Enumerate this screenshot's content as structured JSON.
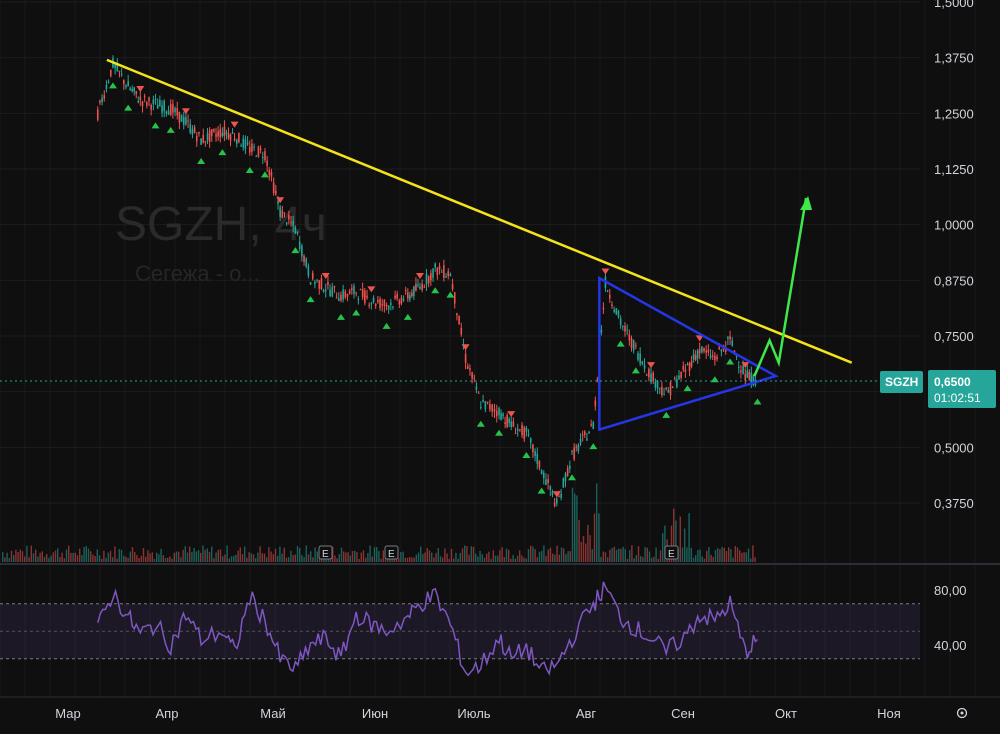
{
  "ticker": "SGZH",
  "watermark": {
    "symbol": "SGZH, 4ч",
    "name": "Сегежа - о..."
  },
  "price_badge": {
    "label": "SGZH",
    "price": "0,6500",
    "countdown": "01:02:51",
    "color": "#26a69a"
  },
  "colors": {
    "up": "#26a69a",
    "down": "#ef5350",
    "trendline": "#f5e31a",
    "triangle": "#2536e6",
    "projection": "#3ee84a",
    "rsi": "#7e57c2"
  },
  "event_marker_label": "E",
  "settings_icon": "gear-icon",
  "chart_data": [
    {
      "type": "line",
      "title": "SGZH, 4ч",
      "x": [
        "2024-02-20",
        "2024-02-25",
        "2024-03-01",
        "2024-03-05",
        "2024-03-10",
        "2024-03-15",
        "2024-03-20",
        "2024-03-25",
        "2024-04-01",
        "2024-04-05",
        "2024-04-10",
        "2024-04-15",
        "2024-04-20",
        "2024-04-25",
        "2024-04-30",
        "2024-05-05",
        "2024-05-10",
        "2024-05-15",
        "2024-05-20",
        "2024-05-25",
        "2024-06-01",
        "2024-06-05",
        "2024-06-10",
        "2024-06-15",
        "2024-06-20",
        "2024-06-25",
        "2024-07-01",
        "2024-07-05",
        "2024-07-10",
        "2024-07-15",
        "2024-07-20",
        "2024-07-25",
        "2024-08-01",
        "2024-08-05",
        "2024-08-10",
        "2024-08-15",
        "2024-08-20",
        "2024-08-25",
        "2024-09-01",
        "2024-09-05",
        "2024-09-10",
        "2024-09-15",
        "2024-09-20",
        "2024-09-24"
      ],
      "series": [
        {
          "values": [
            1.25,
            1.36,
            1.31,
            1.28,
            1.27,
            1.26,
            1.23,
            1.19,
            1.21,
            1.2,
            1.17,
            1.16,
            1.03,
            0.99,
            0.88,
            0.86,
            0.84,
            0.85,
            0.83,
            0.82,
            0.84,
            0.86,
            0.9,
            0.89,
            0.7,
            0.6,
            0.58,
            0.55,
            0.53,
            0.45,
            0.37,
            0.48,
            0.55,
            0.87,
            0.78,
            0.72,
            0.66,
            0.62,
            0.68,
            0.72,
            0.7,
            0.74,
            0.66,
            0.65
          ]
        }
      ],
      "price_axis": {
        "ticks": [
          "1,5000",
          "1,3750",
          "1,2500",
          "1,1250",
          "1,0000",
          "0,8750",
          "0,7500",
          "0,6250",
          "0,5000",
          "0,3750"
        ],
        "ylim": [
          0.32,
          1.5
        ]
      },
      "months": [
        "Мар",
        "Апр",
        "Май",
        "Июн",
        "Июль",
        "Авг",
        "Сен",
        "Окт",
        "Ноя"
      ],
      "annotations": {
        "resistance_line": [
          [
            "2024-02-23",
            1.37
          ],
          [
            "2024-10-25",
            0.69
          ]
        ],
        "triangle": [
          [
            "2024-08-03",
            0.88
          ],
          [
            "2024-09-30",
            0.66
          ],
          [
            "2024-08-03",
            0.54
          ]
        ],
        "projection": [
          [
            "2024-09-23",
            0.66
          ],
          [
            "2024-09-28",
            0.74
          ],
          [
            "2024-10-01",
            0.69
          ],
          [
            "2024-10-10",
            1.06
          ]
        ]
      }
    },
    {
      "type": "line",
      "title": "RSI",
      "x": [
        "2024-02-20",
        "2024-02-25",
        "2024-03-01",
        "2024-03-05",
        "2024-03-10",
        "2024-03-15",
        "2024-03-20",
        "2024-03-25",
        "2024-04-01",
        "2024-04-05",
        "2024-04-10",
        "2024-04-15",
        "2024-04-20",
        "2024-04-25",
        "2024-04-30",
        "2024-05-05",
        "2024-05-10",
        "2024-05-15",
        "2024-05-20",
        "2024-05-25",
        "2024-06-01",
        "2024-06-05",
        "2024-06-10",
        "2024-06-15",
        "2024-06-20",
        "2024-06-25",
        "2024-07-01",
        "2024-07-05",
        "2024-07-10",
        "2024-07-15",
        "2024-07-20",
        "2024-07-25",
        "2024-08-01",
        "2024-08-05",
        "2024-08-10",
        "2024-08-15",
        "2024-08-20",
        "2024-08-25",
        "2024-09-01",
        "2024-09-05",
        "2024-09-10",
        "2024-09-15",
        "2024-09-20",
        "2024-09-24"
      ],
      "series": [
        {
          "values": [
            52,
            78,
            60,
            48,
            55,
            40,
            62,
            44,
            50,
            35,
            75,
            58,
            30,
            22,
            40,
            45,
            30,
            62,
            55,
            50,
            60,
            70,
            76,
            55,
            20,
            25,
            45,
            30,
            38,
            20,
            25,
            45,
            70,
            82,
            60,
            52,
            45,
            35,
            48,
            62,
            58,
            70,
            35,
            44
          ]
        }
      ],
      "axis": {
        "ticks": [
          "80,00",
          "40,00"
        ],
        "ylim": [
          10,
          95
        ]
      },
      "bands": [
        30,
        50,
        70
      ]
    }
  ]
}
